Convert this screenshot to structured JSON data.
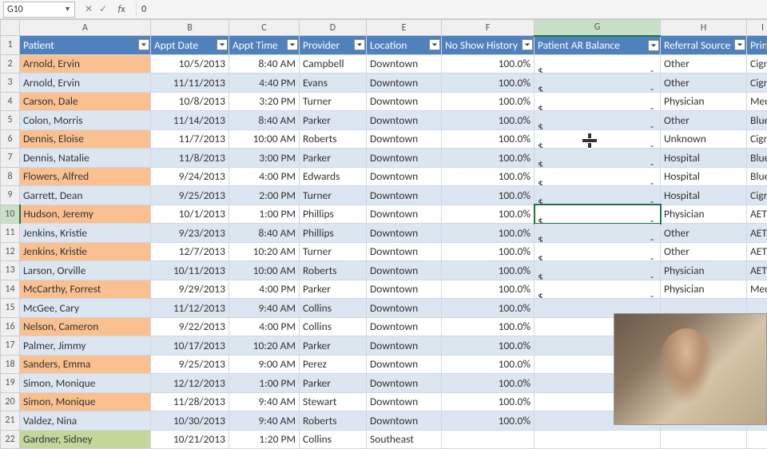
{
  "formula_bar": {
    "name_box": "G10",
    "formula_value": "0"
  },
  "col_letters": [
    "A",
    "B",
    "C",
    "D",
    "E",
    "F",
    "G",
    "H",
    "I"
  ],
  "active": {
    "col_index": 6,
    "row": 10,
    "row_index": 8
  },
  "headers": [
    "Patient",
    "Appt Date",
    "Appt Time",
    "Provider",
    "Location",
    "No Show History",
    "Patient AR Balance",
    "Referral Source",
    "Prim"
  ],
  "rows": [
    {
      "n": 2,
      "p": "Arnold, Ervin",
      "d": "10/5/2013",
      "t": "8:40 AM",
      "pr": "Campbell",
      "l": "Downtown",
      "ns": "100.0%",
      "ar": "-",
      "rs": "Other",
      "pi": "Cign"
    },
    {
      "n": 3,
      "p": "Arnold, Ervin",
      "d": "11/11/2013",
      "t": "4:40 PM",
      "pr": "Evans",
      "l": "Downtown",
      "ns": "100.0%",
      "ar": "-",
      "rs": "Other",
      "pi": "Cign"
    },
    {
      "n": 4,
      "p": "Carson, Dale",
      "d": "10/8/2013",
      "t": "3:20 PM",
      "pr": "Turner",
      "l": "Downtown",
      "ns": "100.0%",
      "ar": "-",
      "rs": "Physician",
      "pi": "Med"
    },
    {
      "n": 5,
      "p": "Colon, Morris",
      "d": "11/14/2013",
      "t": "8:40 AM",
      "pr": "Parker",
      "l": "Downtown",
      "ns": "100.0%",
      "ar": "-",
      "rs": "Other",
      "pi": "Blue"
    },
    {
      "n": 6,
      "p": "Dennis, Eloise",
      "d": "11/7/2013",
      "t": "10:00 AM",
      "pr": "Roberts",
      "l": "Downtown",
      "ns": "100.0%",
      "ar": "-",
      "rs": "Unknown",
      "pi": "Cign"
    },
    {
      "n": 7,
      "p": "Dennis, Natalie",
      "d": "11/8/2013",
      "t": "3:00 PM",
      "pr": "Parker",
      "l": "Downtown",
      "ns": "100.0%",
      "ar": "-",
      "rs": "Hospital",
      "pi": "Blue"
    },
    {
      "n": 8,
      "p": "Flowers, Alfred",
      "d": "9/24/2013",
      "t": "4:00 PM",
      "pr": "Edwards",
      "l": "Downtown",
      "ns": "100.0%",
      "ar": "-",
      "rs": "Hospital",
      "pi": "Blue"
    },
    {
      "n": 9,
      "p": "Garrett, Dean",
      "d": "9/25/2013",
      "t": "2:00 PM",
      "pr": "Turner",
      "l": "Downtown",
      "ns": "100.0%",
      "ar": "-",
      "rs": "Hospital",
      "pi": "Cign"
    },
    {
      "n": 10,
      "p": "Hudson, Jeremy",
      "d": "10/1/2013",
      "t": "1:00 PM",
      "pr": "Phillips",
      "l": "Downtown",
      "ns": "100.0%",
      "ar": "-",
      "rs": "Physician",
      "pi": "AETN"
    },
    {
      "n": 11,
      "p": "Jenkins, Kristie",
      "d": "9/23/2013",
      "t": "8:40 AM",
      "pr": "Phillips",
      "l": "Downtown",
      "ns": "100.0%",
      "ar": "-",
      "rs": "Other",
      "pi": "AETN"
    },
    {
      "n": 12,
      "p": "Jenkins, Kristie",
      "d": "12/7/2013",
      "t": "10:20 AM",
      "pr": "Turner",
      "l": "Downtown",
      "ns": "100.0%",
      "ar": "-",
      "rs": "Other",
      "pi": "AETN"
    },
    {
      "n": 13,
      "p": "Larson, Orville",
      "d": "10/11/2013",
      "t": "10:00 AM",
      "pr": "Roberts",
      "l": "Downtown",
      "ns": "100.0%",
      "ar": "-",
      "rs": "Physician",
      "pi": "AETN"
    },
    {
      "n": 14,
      "p": "McCarthy, Forrest",
      "d": "9/29/2013",
      "t": "4:00 PM",
      "pr": "Parker",
      "l": "Downtown",
      "ns": "100.0%",
      "ar": "-",
      "rs": "Physician",
      "pi": "Med"
    },
    {
      "n": 15,
      "p": "McGee, Cary",
      "d": "11/12/2013",
      "t": "9:40 AM",
      "pr": "Collins",
      "l": "Downtown",
      "ns": "100.0%",
      "ar": "",
      "rs": "",
      "pi": ""
    },
    {
      "n": 16,
      "p": "Nelson, Cameron",
      "d": "9/22/2013",
      "t": "4:00 PM",
      "pr": "Collins",
      "l": "Downtown",
      "ns": "100.0%",
      "ar": "",
      "rs": "",
      "pi": ""
    },
    {
      "n": 17,
      "p": "Palmer, Jimmy",
      "d": "10/17/2013",
      "t": "10:20 AM",
      "pr": "Parker",
      "l": "Downtown",
      "ns": "100.0%",
      "ar": "",
      "rs": "",
      "pi": ""
    },
    {
      "n": 18,
      "p": "Sanders, Emma",
      "d": "9/25/2013",
      "t": "9:00 AM",
      "pr": "Perez",
      "l": "Downtown",
      "ns": "100.0%",
      "ar": "",
      "rs": "",
      "pi": ""
    },
    {
      "n": 19,
      "p": "Simon, Monique",
      "d": "12/12/2013",
      "t": "1:00 PM",
      "pr": "Parker",
      "l": "Downtown",
      "ns": "100.0%",
      "ar": "",
      "rs": "",
      "pi": ""
    },
    {
      "n": 20,
      "p": "Simon, Monique",
      "d": "11/28/2013",
      "t": "9:40 AM",
      "pr": "Stewart",
      "l": "Downtown",
      "ns": "100.0%",
      "ar": "",
      "rs": "",
      "pi": ""
    },
    {
      "n": 21,
      "p": "Valdez, Nina",
      "d": "10/30/2013",
      "t": "9:40 AM",
      "pr": "Roberts",
      "l": "Downtown",
      "ns": "100.0%",
      "ar": "",
      "rs": "",
      "pi": ""
    },
    {
      "n": 22,
      "p": "Gardner, Sidney",
      "d": "10/21/2013",
      "t": "1:20 PM",
      "pr": "Collins",
      "l": "Southeast",
      "ns": "",
      "ar": "",
      "rs": "",
      "pi": "",
      "green": true
    }
  ],
  "ar_symbol": "$"
}
